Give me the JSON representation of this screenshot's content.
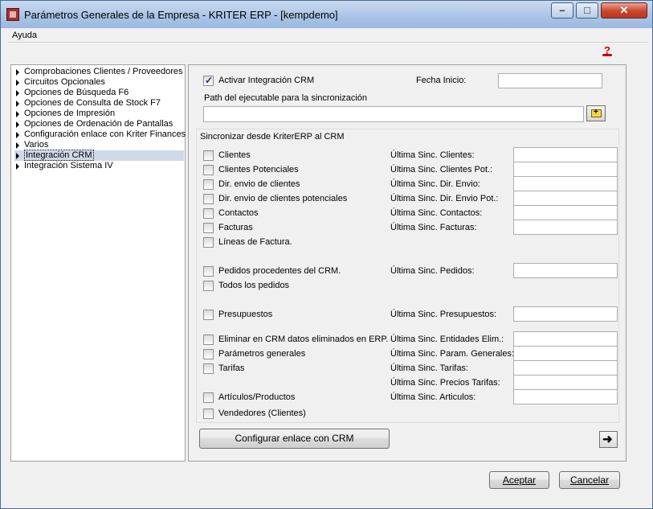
{
  "window": {
    "title": "Parámetros Generales de la Empresa - KRITER ERP - [kempdemo]",
    "minimize_icon": "minimize-icon",
    "maximize_icon": "maximize-icon",
    "close_icon": "close-icon"
  },
  "menu": {
    "items": [
      "Ayuda"
    ]
  },
  "toolbar": {
    "help_icon": "help-icon"
  },
  "tree": {
    "items": [
      "Comprobaciones Clientes / Proveedores",
      "Circuitos Opcionales",
      "Opciones de Búsqueda F6",
      "Opciones de Consulta de Stock F7",
      "Opciones de Impresión",
      "Opciones de Ordenación de Pantallas",
      "Configuración enlace con Kriter Finances",
      "Varios",
      "Integración CRM",
      "Integración Sistema IV"
    ],
    "selected": "Integración CRM"
  },
  "crm": {
    "activate_label": "Activar Integración CRM",
    "activate_checked": true,
    "fecha_inicio_label": "Fecha Inicio:",
    "fecha_inicio_value": "",
    "path_label": "Path del ejecutable para la sincronización",
    "path_value": "",
    "group_title": "Sincronizar desde KriterERP al CRM",
    "rows": [
      {
        "check": "Clientes",
        "sync": "Última Sinc. Clientes:",
        "value": ""
      },
      {
        "check": "Clientes Potenciales",
        "sync": "Última Sinc. Clientes Pot.:",
        "value": ""
      },
      {
        "check": "Dir. envio de clientes",
        "sync": "Última Sinc. Dir. Envio:",
        "value": ""
      },
      {
        "check": "Dir. envio de clientes potenciales",
        "sync": "Última Sinc. Dir. Envio Pot.:",
        "value": ""
      },
      {
        "check": "Contactos",
        "sync": "Última Sinc. Contactos:",
        "value": ""
      },
      {
        "check": "Facturas",
        "sync": "Última Sinc. Facturas:",
        "value": ""
      },
      {
        "check": "Líneas de Factura.",
        "sync": "",
        "value": ""
      },
      {
        "check": "Pedidos procedentes del CRM.",
        "sync": "Última Sinc. Pedidos:",
        "value": ""
      },
      {
        "check": "Todos los pedidos",
        "sync": "",
        "value": ""
      },
      {
        "check": "Presupuestos",
        "sync": "Última Sinc. Presupuestos:",
        "value": ""
      },
      {
        "check": "Eliminar en CRM datos eliminados en ERP.",
        "sync": "Última Sinc. Entidades Elim.:",
        "value": ""
      },
      {
        "check": "Parámetros generales",
        "sync": "Última Sinc. Param. Generales:",
        "value": ""
      },
      {
        "check": "Tarifas",
        "sync": "Última Sinc. Tarifas:",
        "value": ""
      },
      {
        "check": "",
        "sync": "Última Sinc. Precios Tarifas:",
        "value": ""
      },
      {
        "check": "Artículos/Productos",
        "sync": "Última Sinc. Articulos:",
        "value": ""
      },
      {
        "check": "Vendedores (Clientes)",
        "sync": "",
        "value": ""
      }
    ],
    "configure_button": "Configurar enlace con CRM",
    "next_icon": "arrow-right-icon",
    "folder_icon": "folder-icon"
  },
  "footer": {
    "accept_label": "Aceptar",
    "cancel_label": "Cancelar"
  }
}
